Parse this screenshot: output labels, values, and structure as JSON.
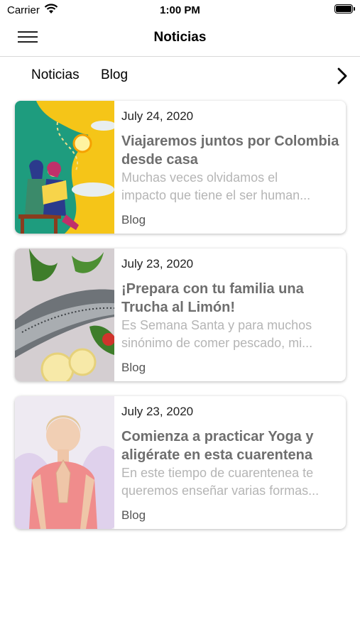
{
  "status_bar": {
    "carrier": "Carrier",
    "time": "1:00 PM"
  },
  "nav": {
    "title": "Noticias"
  },
  "tabs": [
    {
      "label": "Noticias"
    },
    {
      "label": "Blog"
    }
  ],
  "articles": [
    {
      "date": "July 24, 2020",
      "title": "Viajaremos juntos por Colombia desde casa",
      "excerpt_line1": "Muchas veces olvidamos el",
      "excerpt_line2": "impacto que tiene el ser human...",
      "category": "Blog",
      "image": "illustration-reading-women"
    },
    {
      "date": "July 23, 2020",
      "title": "¡Prepara con tu familia una Trucha al Limón!",
      "excerpt_line1": "Es Semana Santa y para muchos",
      "excerpt_line2": "sinónimo de comer pescado, mi...",
      "category": "Blog",
      "image": "photo-trout-lemon"
    },
    {
      "date": "July 23, 2020",
      "title": "Comienza a practicar Yoga y aligérate en esta cuarentena",
      "excerpt_line1": "En este tiempo de cuarentenea te",
      "excerpt_line2": "queremos enseñar varias formas...",
      "category": "Blog",
      "image": "photo-yoga-woman"
    }
  ]
}
